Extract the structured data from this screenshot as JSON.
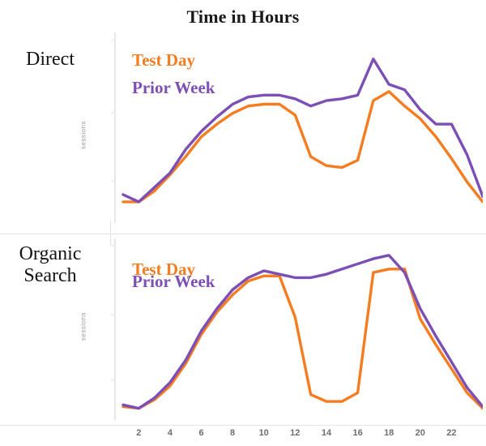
{
  "title": "Time in Hours",
  "colors": {
    "test_day": "#F57C20",
    "prior_week": "#7B4FB5",
    "axis": "#e6e6e6",
    "tick_text": "#6e6e6e",
    "row_label": "#141414",
    "axis_label": "#9a9a9a"
  },
  "rows": [
    {
      "id": "direct",
      "label": "Direct"
    },
    {
      "id": "organic",
      "label": "Organic\nSearch"
    }
  ],
  "row_labels": {
    "direct": "Direct",
    "organic_line1": "Organic",
    "organic_line2": "Search"
  },
  "legend": {
    "test_day": "Test Day",
    "prior_week": "Prior Week"
  },
  "axis": {
    "ylabel": "sessions",
    "xtick_labels": [
      "2",
      "4",
      "6",
      "8",
      "10",
      "12",
      "14",
      "16",
      "18",
      "20",
      "22"
    ]
  },
  "chart_data": [
    {
      "type": "line",
      "title": "Direct",
      "subtitle": "Time in Hours",
      "xlabel": "Time in Hours",
      "ylabel": "sessions",
      "grid": false,
      "legend_position": "inside-top-left",
      "x": [
        1,
        2,
        3,
        4,
        5,
        6,
        7,
        8,
        9,
        10,
        11,
        12,
        13,
        14,
        15,
        16,
        17,
        18,
        19,
        20,
        21,
        22,
        23,
        24
      ],
      "xlim": [
        1,
        24
      ],
      "ylim": [
        0,
        100
      ],
      "xticks": [
        2,
        4,
        6,
        8,
        10,
        12,
        14,
        16,
        18,
        20,
        22
      ],
      "series": [
        {
          "name": "Test Day",
          "color": "#F57C20",
          "values": [
            9,
            9,
            15,
            24,
            34,
            45,
            52,
            58,
            62,
            63,
            63,
            57,
            34,
            29,
            28,
            32,
            65,
            70,
            62,
            55,
            45,
            33,
            20,
            9
          ]
        },
        {
          "name": "Prior Week",
          "color": "#7B4FB5",
          "values": [
            13,
            9,
            17,
            25,
            38,
            48,
            56,
            63,
            67,
            68,
            68,
            66,
            62,
            65,
            66,
            68,
            88,
            74,
            71,
            60,
            52,
            52,
            35,
            12
          ]
        }
      ]
    },
    {
      "type": "line",
      "title": "Organic Search",
      "subtitle": "Time in Hours",
      "xlabel": "Time in Hours",
      "ylabel": "sessions",
      "grid": false,
      "legend_position": "inside-top-left",
      "x": [
        1,
        2,
        3,
        4,
        5,
        6,
        7,
        8,
        9,
        10,
        11,
        12,
        13,
        14,
        15,
        16,
        17,
        18,
        19,
        20,
        21,
        22,
        23,
        24
      ],
      "xlim": [
        1,
        24
      ],
      "ylim": [
        0,
        100
      ],
      "xticks": [
        2,
        4,
        6,
        8,
        10,
        12,
        14,
        16,
        18,
        20,
        22
      ],
      "series": [
        {
          "name": "Test Day",
          "color": "#F57C20",
          "values": [
            5,
            4,
            9,
            17,
            30,
            47,
            60,
            70,
            78,
            81,
            81,
            57,
            12,
            8,
            8,
            13,
            83,
            85,
            85,
            56,
            41,
            27,
            13,
            4
          ]
        },
        {
          "name": "Prior Week",
          "color": "#7B4FB5",
          "values": [
            6,
            4,
            10,
            19,
            32,
            49,
            62,
            73,
            80,
            84,
            82,
            80,
            80,
            82,
            85,
            88,
            91,
            93,
            83,
            62,
            46,
            31,
            16,
            5
          ]
        }
      ]
    }
  ]
}
